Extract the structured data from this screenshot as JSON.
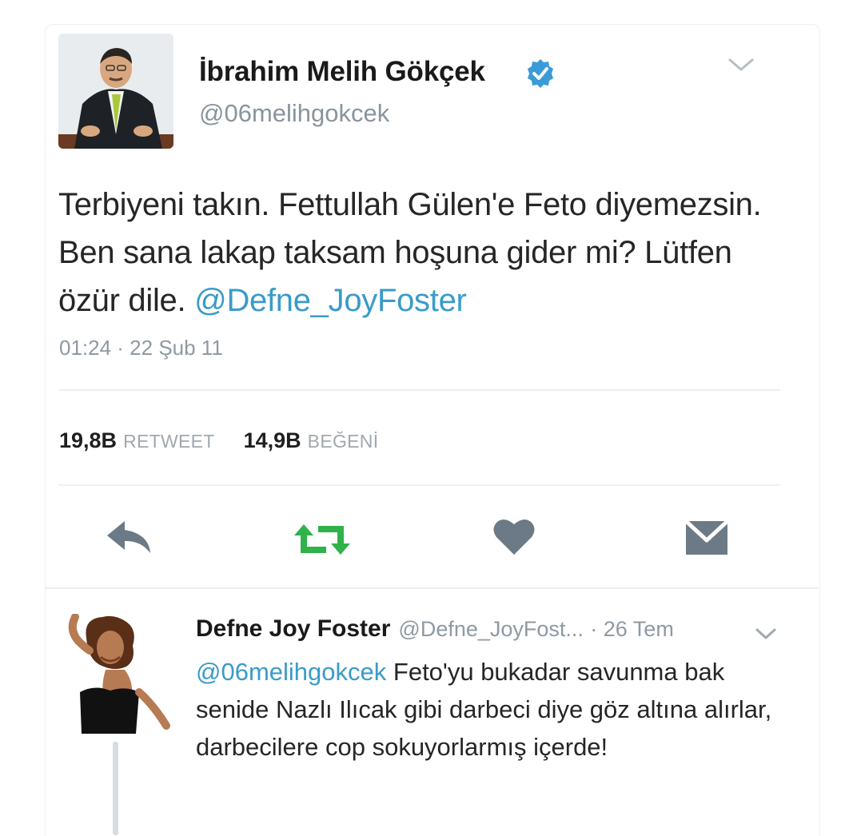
{
  "tweet": {
    "author": {
      "display_name": "İbrahim Melih Gökçek",
      "handle": "@06melihgokcek",
      "verified": true
    },
    "text": "Terbiyeni takın. Fettullah Gülen'e Feto diyemezsin. Ben sana lakap taksam hoşuna gider mi? Lütfen özür dile.",
    "mention": "@Defne_JoyFoster",
    "timestamp": "01:24 · 22 Şub 11",
    "stats": {
      "retweet_count": "19,8B",
      "retweet_label": "RETWEET",
      "like_count": "14,9B",
      "like_label": "BEĞENİ"
    },
    "actions": {
      "reply_icon": "reply-arrow",
      "retweet_icon": "retweet-arrows",
      "like_icon": "heart",
      "dm_icon": "envelope"
    }
  },
  "reply": {
    "display_name": "Defne Joy Foster",
    "handle": "@Defne_JoyFost...",
    "time": "· 26 Tem",
    "mention": "@06melihgokcek",
    "text": "Feto'yu bukadar savunma bak senide Nazlı Ilıcak gibi darbeci diye göz altına alırlar, darbecilere cop sokuyorlarmış içerde!"
  },
  "colors": {
    "link": "#3a9bc9",
    "verified": "#3a9bd8",
    "retweet_active": "#2fb24a",
    "icon_gray": "#6b7a86",
    "meta_gray": "#8f99a2"
  }
}
